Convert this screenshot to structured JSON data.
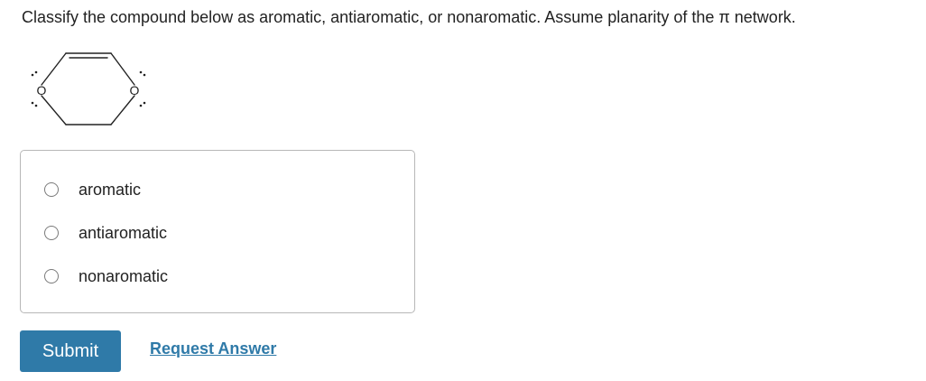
{
  "question": {
    "text": "Classify the compound below as aromatic, antiaromatic, or nonaromatic. Assume planarity of the π network."
  },
  "structure": {
    "atom_left": "O",
    "atom_right": "O"
  },
  "options": [
    {
      "label": "aromatic",
      "selected": false
    },
    {
      "label": "antiaromatic",
      "selected": false
    },
    {
      "label": "nonaromatic",
      "selected": false
    }
  ],
  "actions": {
    "submit_label": "Submit",
    "request_answer_label": "Request Answer"
  },
  "colors": {
    "accent": "#2f7aa8",
    "border": "#b7b7b7",
    "text": "#222222"
  }
}
